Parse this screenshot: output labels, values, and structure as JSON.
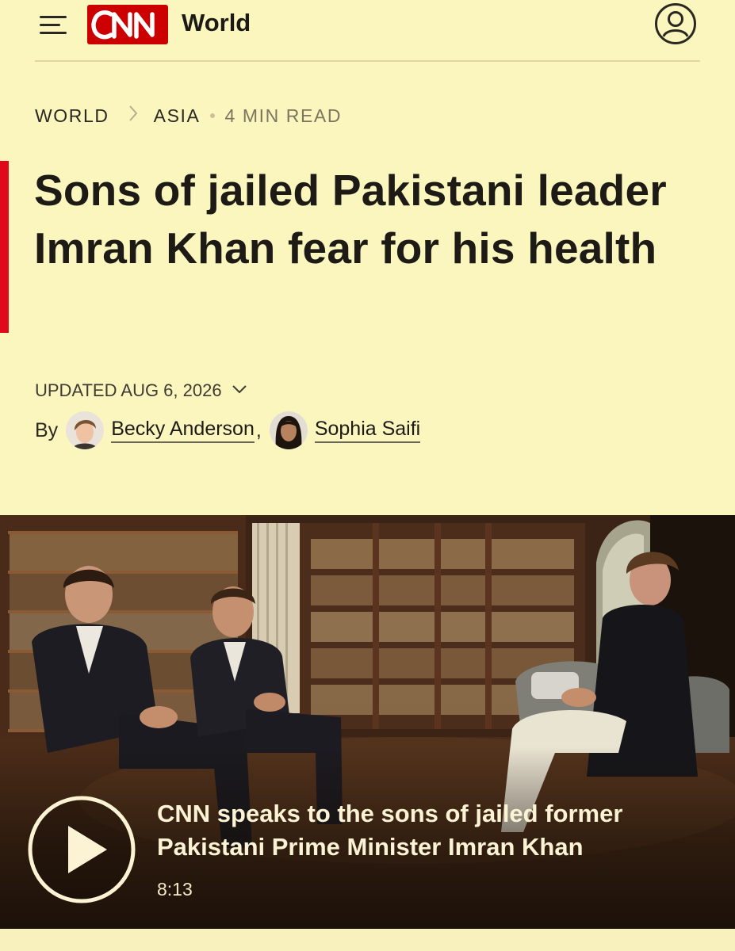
{
  "header": {
    "logo": "CNN",
    "section": "World",
    "menu_icon": "hamburger-menu-icon",
    "account_icon": "user-account-icon"
  },
  "breadcrumb": {
    "items": [
      "WORLD",
      "ASIA"
    ],
    "read_time": "4 MIN READ"
  },
  "article": {
    "headline": "Sons of jailed Pakistani leader Imran Khan fear for his health",
    "updated": "UPDATED AUG 6, 2026",
    "by_label": "By",
    "authors": [
      "Becky Anderson",
      "Sophia Saifi"
    ],
    "author_separator": ","
  },
  "video": {
    "caption": "CNN speaks to the sons of jailed former Pakistani Prime Minister Imran Khan",
    "duration": "8:13"
  },
  "colors": {
    "brand_red": "#cc0000",
    "accent_bar": "#e0091c",
    "page_background": "#fbf6be"
  }
}
